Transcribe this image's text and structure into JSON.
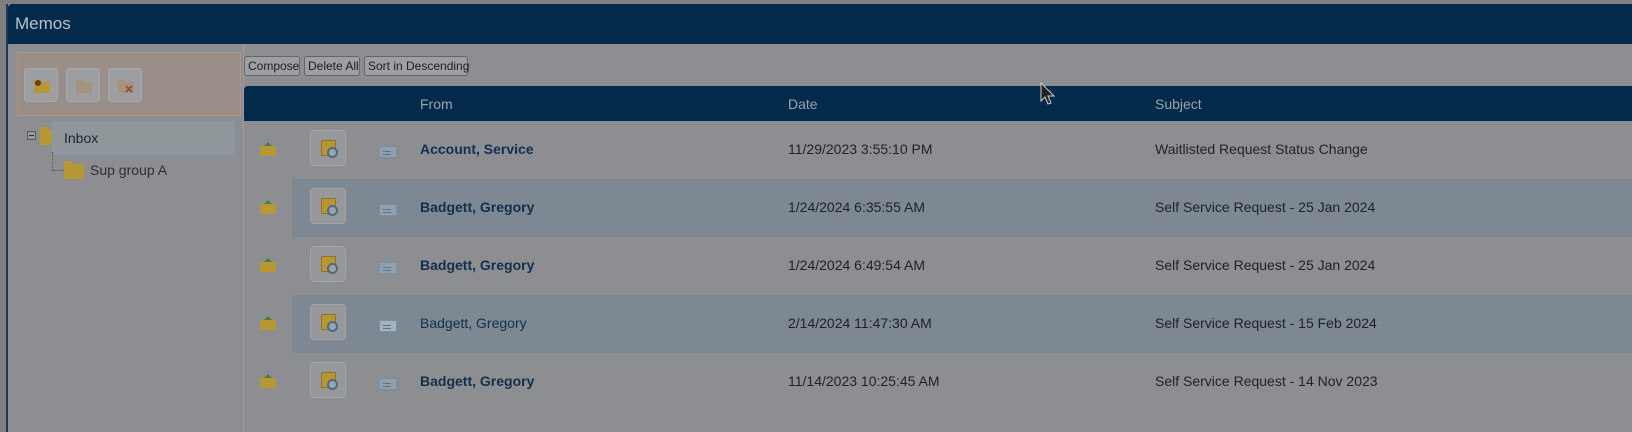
{
  "window": {
    "title": "Memos"
  },
  "toolbar_icons": [
    {
      "icon": "new-folder-icon",
      "label": ""
    },
    {
      "icon": "folder-icon",
      "label": ""
    },
    {
      "icon": "delete-folder-icon",
      "label": ""
    }
  ],
  "tree": {
    "root": {
      "label": "Inbox",
      "icon": "folder-icon",
      "expanded": true
    },
    "children": [
      {
        "label": "Sup group A",
        "icon": "folder-icon"
      }
    ]
  },
  "actions": {
    "compose": "Compose",
    "delete_all": "Delete All",
    "sort": "Sort in Descending"
  },
  "grid": {
    "columns": {
      "from": "From",
      "date": "Date",
      "subject": "Subject"
    },
    "rows": [
      {
        "from": "Account, Service",
        "date": "11/29/2023 3:55:10 PM",
        "subject": "Waitlisted Request Status Change",
        "unread": true
      },
      {
        "from": "Badgett, Gregory",
        "date": "1/24/2024 6:35:55 AM",
        "subject": "Self Service Request - 25 Jan 2024",
        "unread": true
      },
      {
        "from": "Badgett, Gregory",
        "date": "1/24/2024 6:49:54 AM",
        "subject": "Self Service Request - 25 Jan 2024",
        "unread": true
      },
      {
        "from": "Badgett, Gregory",
        "date": "2/14/2024 11:47:30 AM",
        "subject": "Self Service Request - 15 Feb 2024",
        "unread": false
      },
      {
        "from": "Badgett, Gregory",
        "date": "11/14/2023 10:25:45 AM",
        "subject": "Self Service Request - 14 Nov 2023",
        "unread": true
      }
    ]
  },
  "colors": {
    "header_bg": "#032a4a",
    "overlay_bg": "#8c8e92",
    "folder": "#b79836",
    "link": "#12304c"
  }
}
